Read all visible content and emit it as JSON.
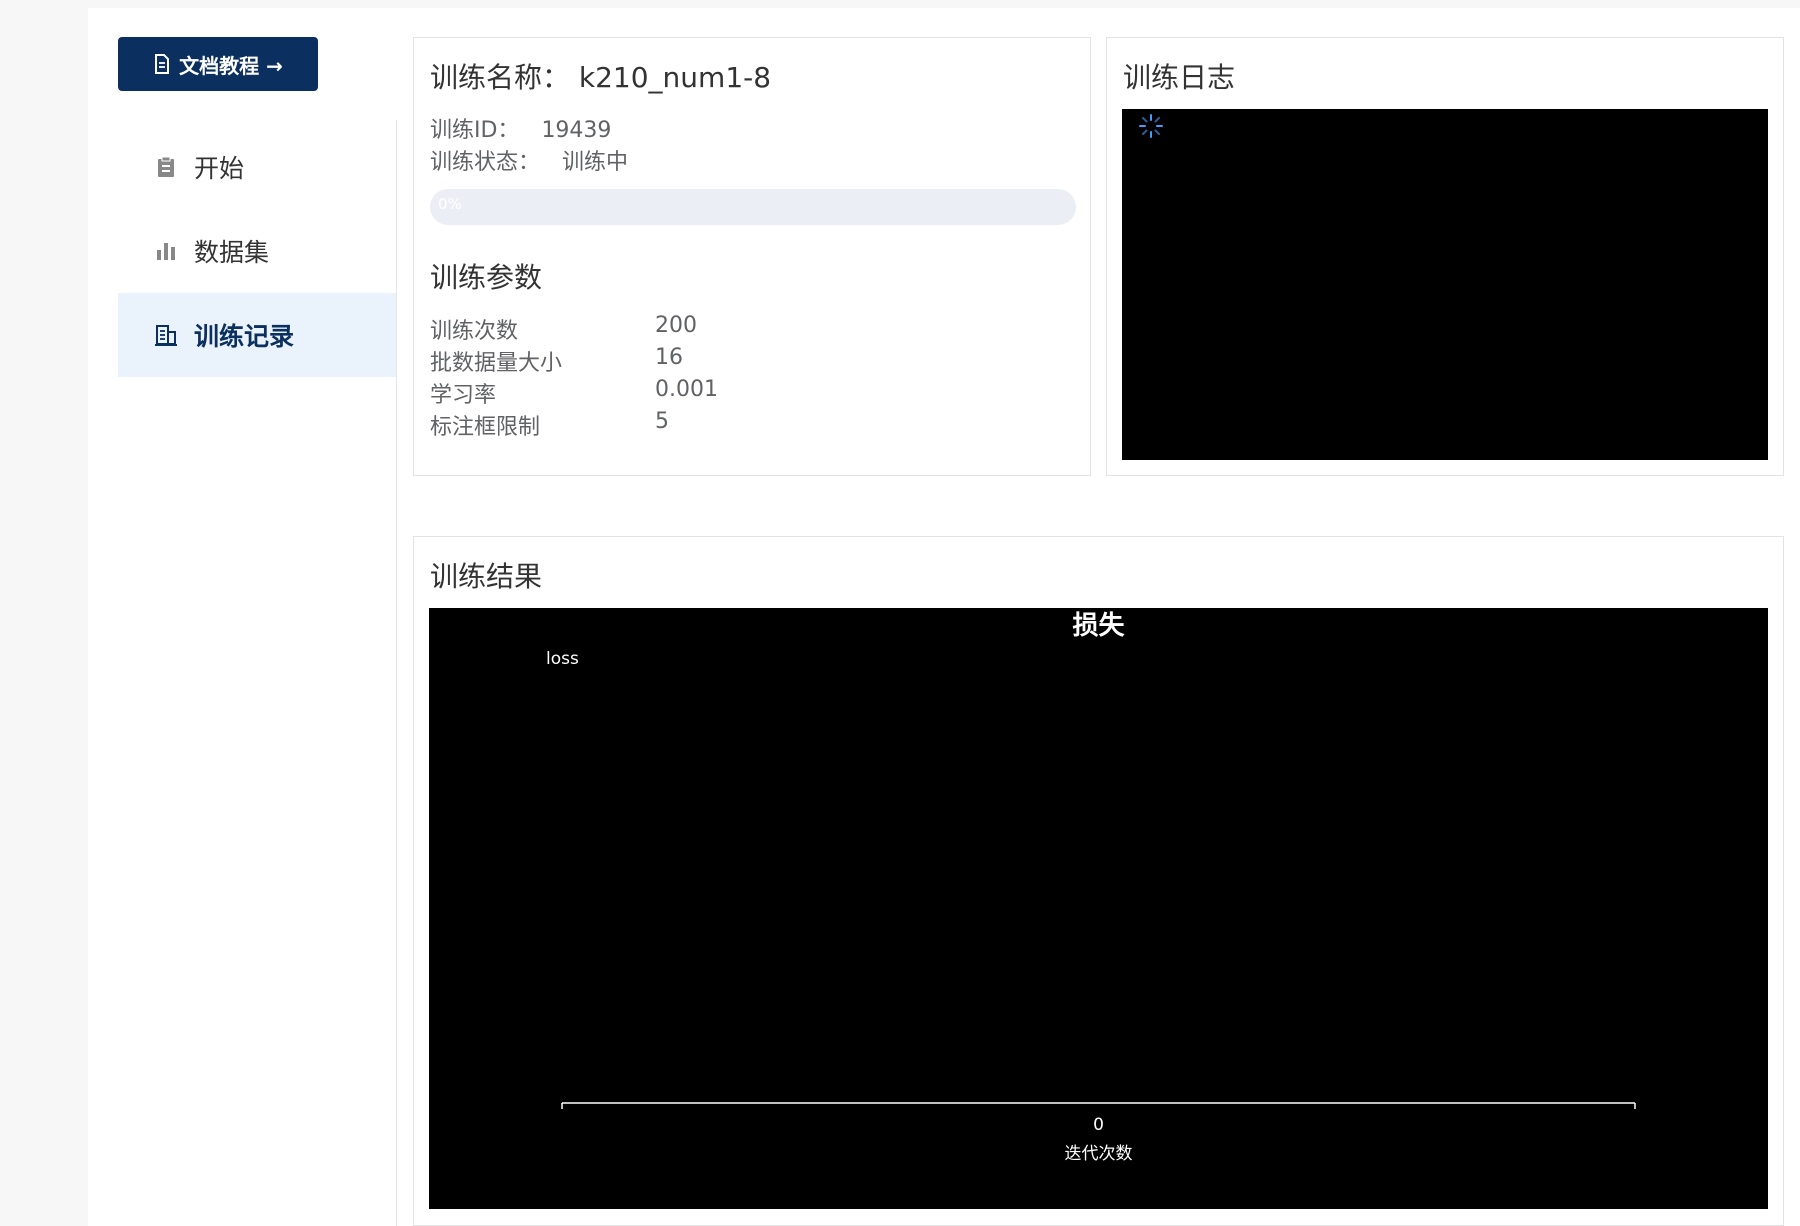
{
  "sidebar": {
    "doc_button_label": "文档教程 →",
    "items": [
      {
        "label": "开始",
        "icon": "clipboard-icon",
        "active": false
      },
      {
        "label": "数据集",
        "icon": "bar-chart-icon",
        "active": false
      },
      {
        "label": "训练记录",
        "icon": "record-icon",
        "active": true
      }
    ]
  },
  "info": {
    "title": "训练名称： k210_num1-8",
    "id_label": "训练ID：",
    "id_value": "19439",
    "status_label": "训练状态：",
    "status_value": "训练中",
    "progress_percent": 0,
    "progress_text": "0%"
  },
  "params": {
    "title": "训练参数",
    "rows": [
      {
        "label": "训练次数",
        "value": "200"
      },
      {
        "label": "批数据量大小",
        "value": "16"
      },
      {
        "label": "学习率",
        "value": "0.001"
      },
      {
        "label": "标注框限制",
        "value": "5"
      }
    ]
  },
  "log": {
    "title": "训练日志",
    "spinner_icon": "loading-spinner-icon"
  },
  "result": {
    "title": "训练结果"
  },
  "chart_data": {
    "type": "line",
    "title": "损失",
    "xlabel": "迭代次数",
    "ylabel": "",
    "x_ticks": [
      "0"
    ],
    "series": [
      {
        "name": "loss",
        "values": []
      }
    ],
    "legend_position": "top-left",
    "grid": false
  },
  "colors": {
    "primary": "#0b2f5e",
    "active_bg": "#eaf3fc",
    "progress_track": "#ebeef5",
    "spinner": "#409eff",
    "chart_bg": "#000000"
  }
}
